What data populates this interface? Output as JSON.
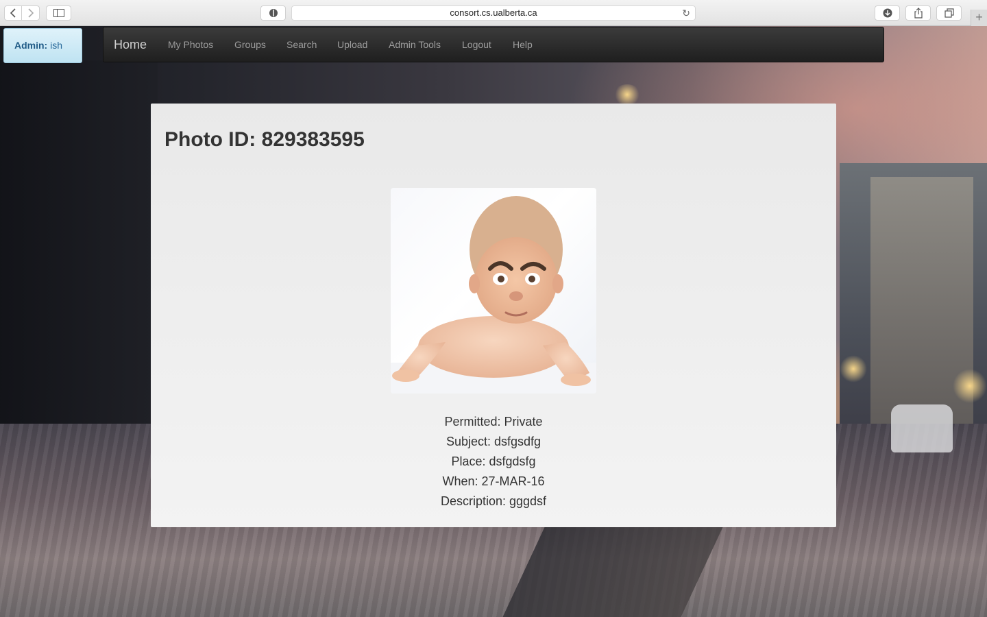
{
  "browser": {
    "url": "consort.cs.ualberta.ca"
  },
  "admin_badge": {
    "label": "Admin:",
    "username": "ish"
  },
  "navbar": {
    "brand": "Home",
    "items": [
      {
        "label": "My Photos"
      },
      {
        "label": "Groups"
      },
      {
        "label": "Search"
      },
      {
        "label": "Upload"
      },
      {
        "label": "Admin Tools"
      },
      {
        "label": "Logout"
      },
      {
        "label": "Help"
      }
    ]
  },
  "photo": {
    "title": "Photo ID: 829383595",
    "image_icon": "baby-photo",
    "details": {
      "permitted": "Permitted: Private",
      "subject": "Subject: dsfgsdfg",
      "place": "Place: dsfgdsfg",
      "when": "When: 27-MAR-16",
      "description": "Description: gggdsf"
    }
  }
}
